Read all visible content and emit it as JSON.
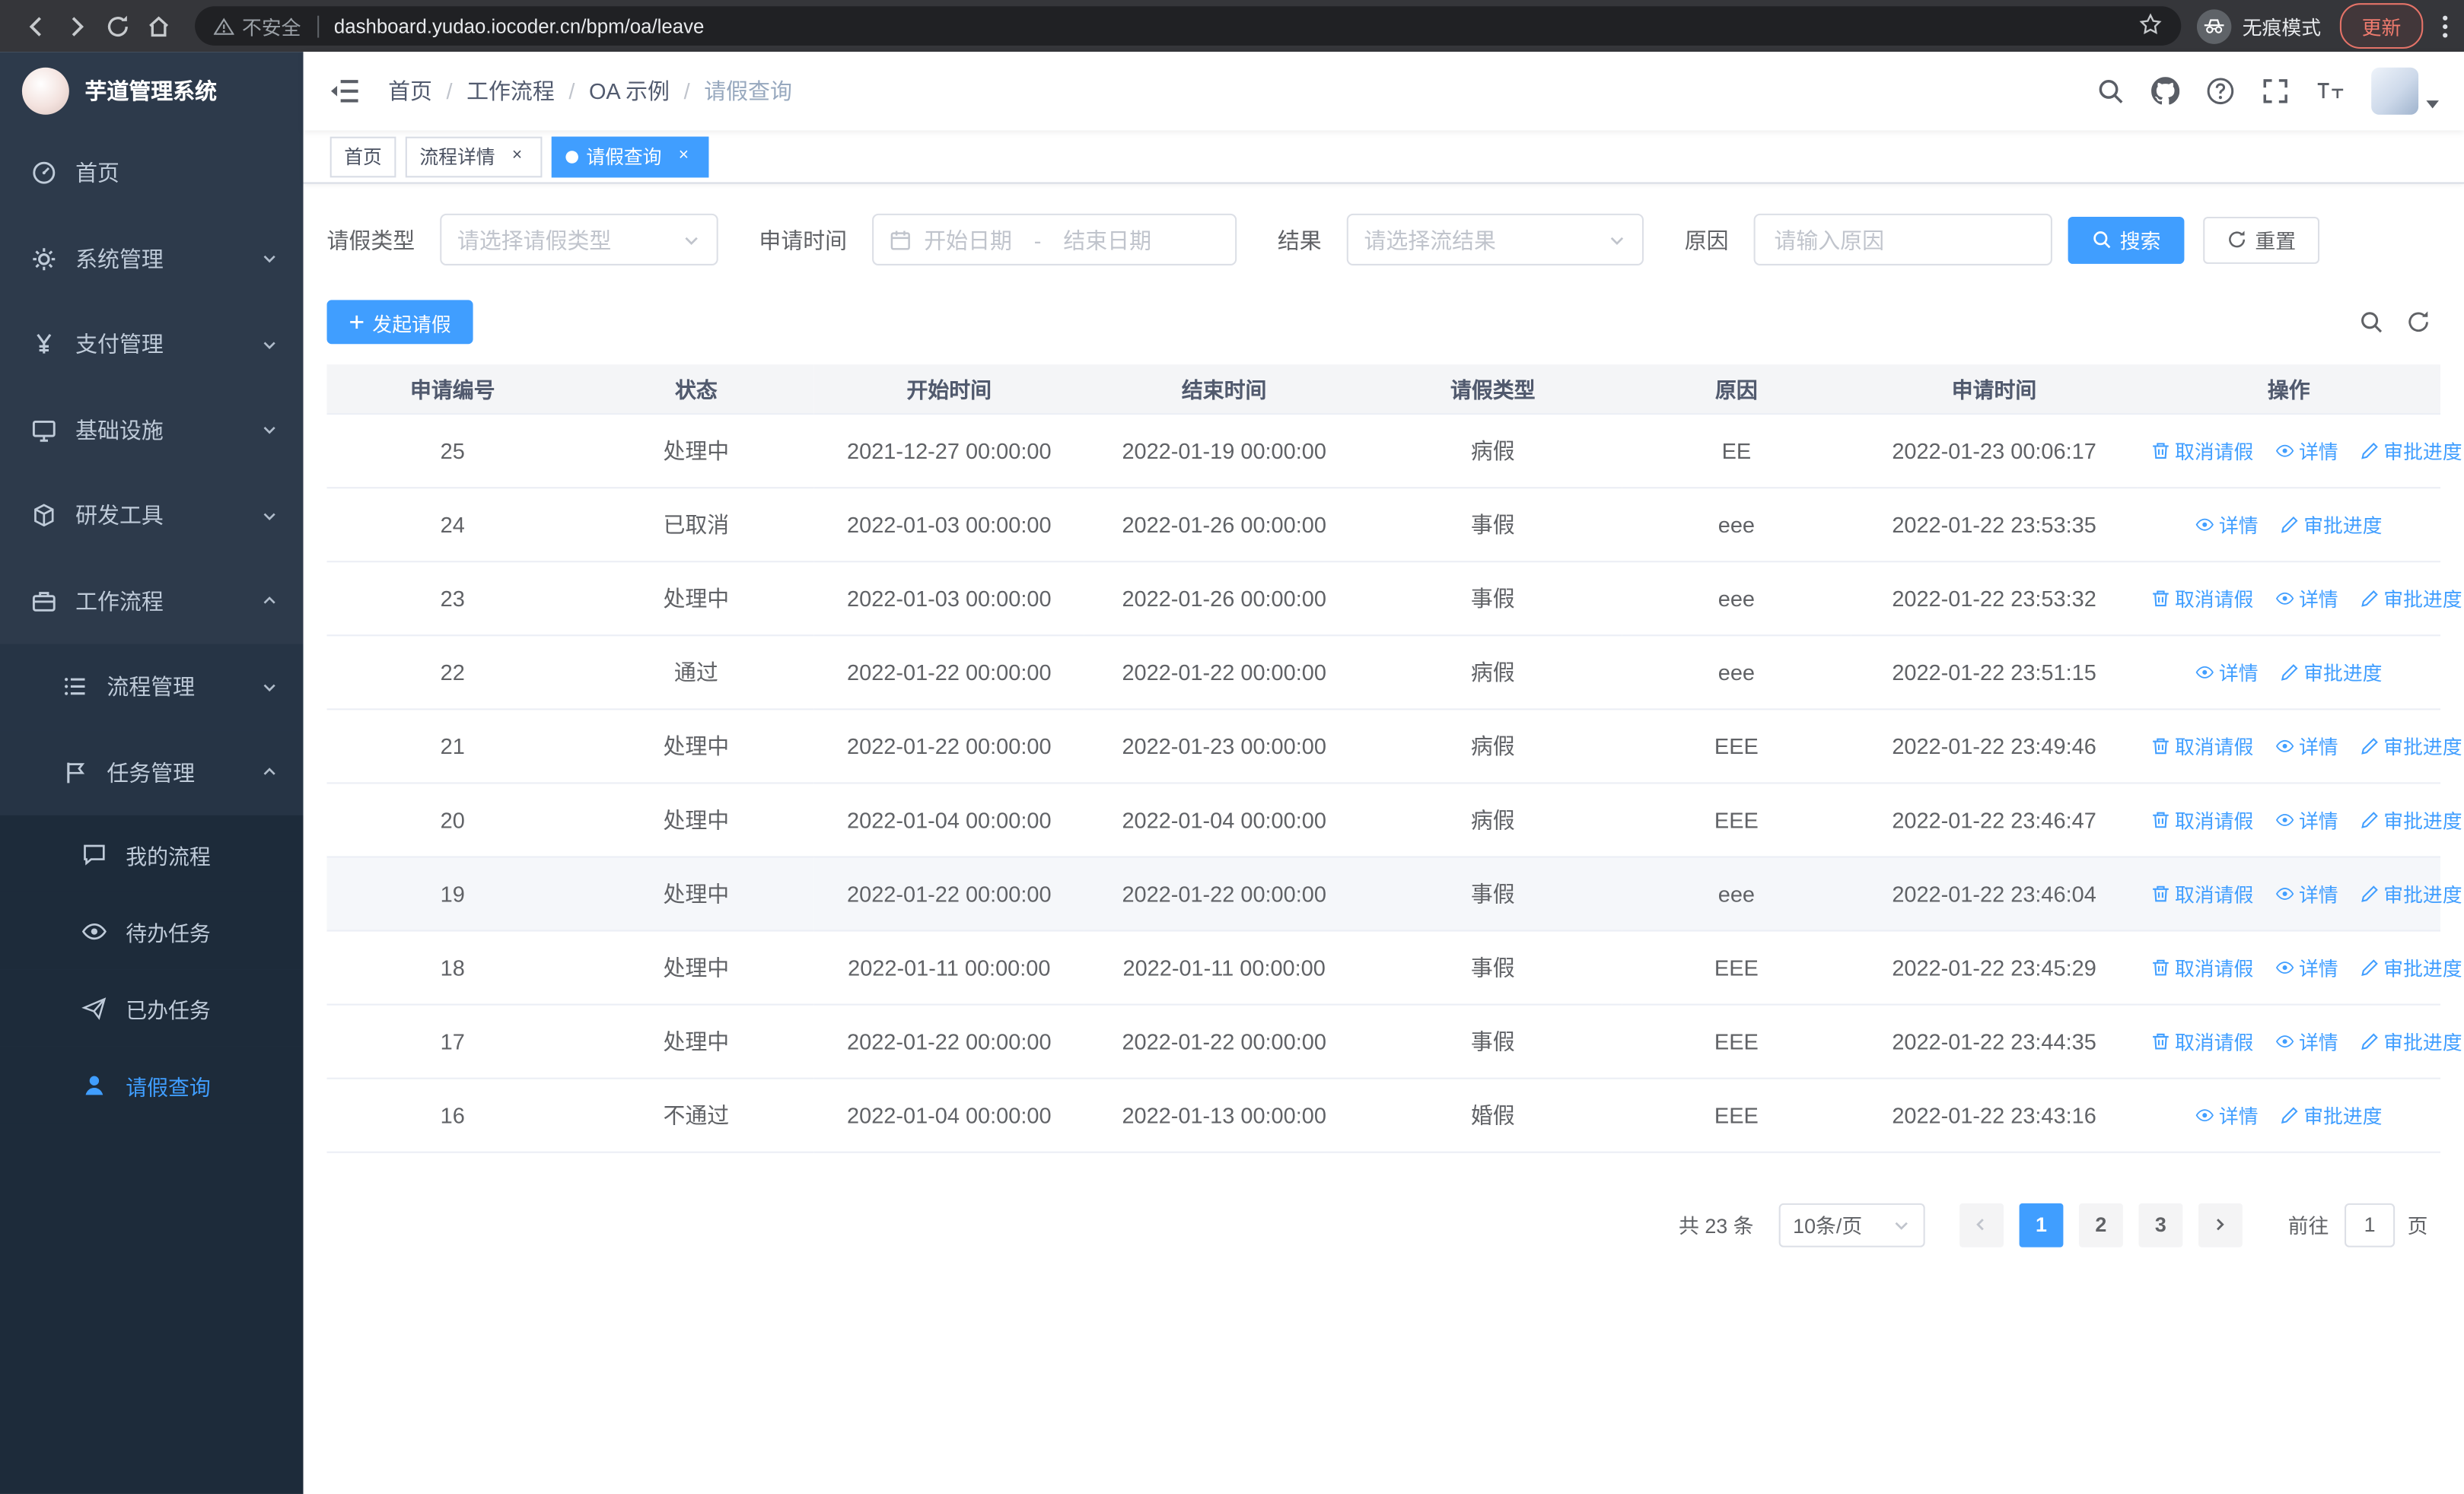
{
  "browser": {
    "security_label": "不安全",
    "url": "dashboard.yudao.iocoder.cn/bpm/oa/leave",
    "incognito_label": "无痕模式",
    "update_label": "更新"
  },
  "sidebar": {
    "app_title": "芋道管理系统",
    "items": [
      {
        "label": "首页",
        "icon": "dashboard-icon",
        "state": "none"
      },
      {
        "label": "系统管理",
        "icon": "gear-icon",
        "state": "collapsed"
      },
      {
        "label": "支付管理",
        "icon": "yen-icon",
        "state": "collapsed"
      },
      {
        "label": "基础设施",
        "icon": "monitor-icon",
        "state": "collapsed"
      },
      {
        "label": "研发工具",
        "icon": "cube-icon",
        "state": "collapsed"
      },
      {
        "label": "工作流程",
        "icon": "briefcase-icon",
        "state": "expanded"
      }
    ],
    "workflow_children": [
      {
        "label": "流程管理",
        "icon": "list-icon",
        "state": "collapsed"
      },
      {
        "label": "任务管理",
        "icon": "flag-icon",
        "state": "expanded"
      }
    ],
    "task_children": [
      {
        "label": "我的流程",
        "icon": "chat-icon",
        "active": false
      },
      {
        "label": "待办任务",
        "icon": "eye-icon",
        "active": false
      },
      {
        "label": "已办任务",
        "icon": "send-icon",
        "active": false
      },
      {
        "label": "请假查询",
        "icon": "user-icon",
        "active": true
      }
    ]
  },
  "header": {
    "breadcrumb": [
      "首页",
      "工作流程",
      "OA 示例",
      "请假查询"
    ],
    "breadcrumb_separator": "/"
  },
  "tabs": [
    {
      "label": "首页",
      "closable": false,
      "active": false
    },
    {
      "label": "流程详情",
      "closable": true,
      "active": false
    },
    {
      "label": "请假查询",
      "closable": true,
      "active": true
    }
  ],
  "filters": {
    "leave_type_label": "请假类型",
    "leave_type_placeholder": "请选择请假类型",
    "apply_time_label": "申请时间",
    "start_date_placeholder": "开始日期",
    "range_separator": "-",
    "end_date_placeholder": "结束日期",
    "result_label": "结果",
    "result_placeholder": "请选择流结果",
    "reason_label": "原因",
    "reason_placeholder": "请输入原因",
    "search_button": "搜索",
    "reset_button": "重置"
  },
  "toolbar": {
    "create_button": "发起请假"
  },
  "table": {
    "columns": [
      "申请编号",
      "状态",
      "开始时间",
      "结束时间",
      "请假类型",
      "原因",
      "申请时间",
      "操作"
    ],
    "action_labels": {
      "cancel": "取消请假",
      "detail": "详情",
      "progress": "审批进度"
    },
    "rows": [
      {
        "id": "25",
        "status": "处理中",
        "start": "2021-12-27 00:00:00",
        "end": "2022-01-19 00:00:00",
        "type": "病假",
        "reason": "EE",
        "applied": "2022-01-23 00:06:17",
        "cancelable": true,
        "highlighted": false
      },
      {
        "id": "24",
        "status": "已取消",
        "start": "2022-01-03 00:00:00",
        "end": "2022-01-26 00:00:00",
        "type": "事假",
        "reason": "eee",
        "applied": "2022-01-22 23:53:35",
        "cancelable": false,
        "highlighted": false
      },
      {
        "id": "23",
        "status": "处理中",
        "start": "2022-01-03 00:00:00",
        "end": "2022-01-26 00:00:00",
        "type": "事假",
        "reason": "eee",
        "applied": "2022-01-22 23:53:32",
        "cancelable": true,
        "highlighted": false
      },
      {
        "id": "22",
        "status": "通过",
        "start": "2022-01-22 00:00:00",
        "end": "2022-01-22 00:00:00",
        "type": "病假",
        "reason": "eee",
        "applied": "2022-01-22 23:51:15",
        "cancelable": false,
        "highlighted": false
      },
      {
        "id": "21",
        "status": "处理中",
        "start": "2022-01-22 00:00:00",
        "end": "2022-01-23 00:00:00",
        "type": "病假",
        "reason": "EEE",
        "applied": "2022-01-22 23:49:46",
        "cancelable": true,
        "highlighted": false
      },
      {
        "id": "20",
        "status": "处理中",
        "start": "2022-01-04 00:00:00",
        "end": "2022-01-04 00:00:00",
        "type": "病假",
        "reason": "EEE",
        "applied": "2022-01-22 23:46:47",
        "cancelable": true,
        "highlighted": false
      },
      {
        "id": "19",
        "status": "处理中",
        "start": "2022-01-22 00:00:00",
        "end": "2022-01-22 00:00:00",
        "type": "事假",
        "reason": "eee",
        "applied": "2022-01-22 23:46:04",
        "cancelable": true,
        "highlighted": true
      },
      {
        "id": "18",
        "status": "处理中",
        "start": "2022-01-11 00:00:00",
        "end": "2022-01-11 00:00:00",
        "type": "事假",
        "reason": "EEE",
        "applied": "2022-01-22 23:45:29",
        "cancelable": true,
        "highlighted": false
      },
      {
        "id": "17",
        "status": "处理中",
        "start": "2022-01-22 00:00:00",
        "end": "2022-01-22 00:00:00",
        "type": "事假",
        "reason": "EEE",
        "applied": "2022-01-22 23:44:35",
        "cancelable": true,
        "highlighted": false
      },
      {
        "id": "16",
        "status": "不通过",
        "start": "2022-01-04 00:00:00",
        "end": "2022-01-13 00:00:00",
        "type": "婚假",
        "reason": "EEE",
        "applied": "2022-01-22 23:43:16",
        "cancelable": false,
        "highlighted": false
      }
    ]
  },
  "pagination": {
    "total_label": "共 23 条",
    "page_size": "10条/页",
    "pages": [
      "1",
      "2",
      "3"
    ],
    "active_page": "1",
    "goto_label": "前往",
    "goto_value": "1",
    "page_suffix": "页"
  },
  "colors": {
    "accent": "#409eff",
    "sidebar_bg": "#2d3a4b",
    "submenu_bg": "#1d2b3a",
    "tab_active_bg": "#409eff",
    "table_header_bg": "#f4f5f7",
    "update_pill": "#f07b6e"
  },
  "icons": {
    "back": "left-arrow",
    "forward": "right-arrow",
    "reload": "circular-arrow",
    "home": "house",
    "warning": "triangle-exclamation",
    "star": "star-outline",
    "incognito": "hat-and-glasses",
    "more": "vertical-dots",
    "hamburger": "menu-lines",
    "search": "magnifier",
    "github": "octocat",
    "help": "question-circle",
    "fullscreen": "expand-corners",
    "font_size": "double-T",
    "calendar": "calendar",
    "plus": "plus",
    "refresh": "circular-arrows",
    "cancel": "trash",
    "detail": "eye",
    "progress": "pen"
  }
}
